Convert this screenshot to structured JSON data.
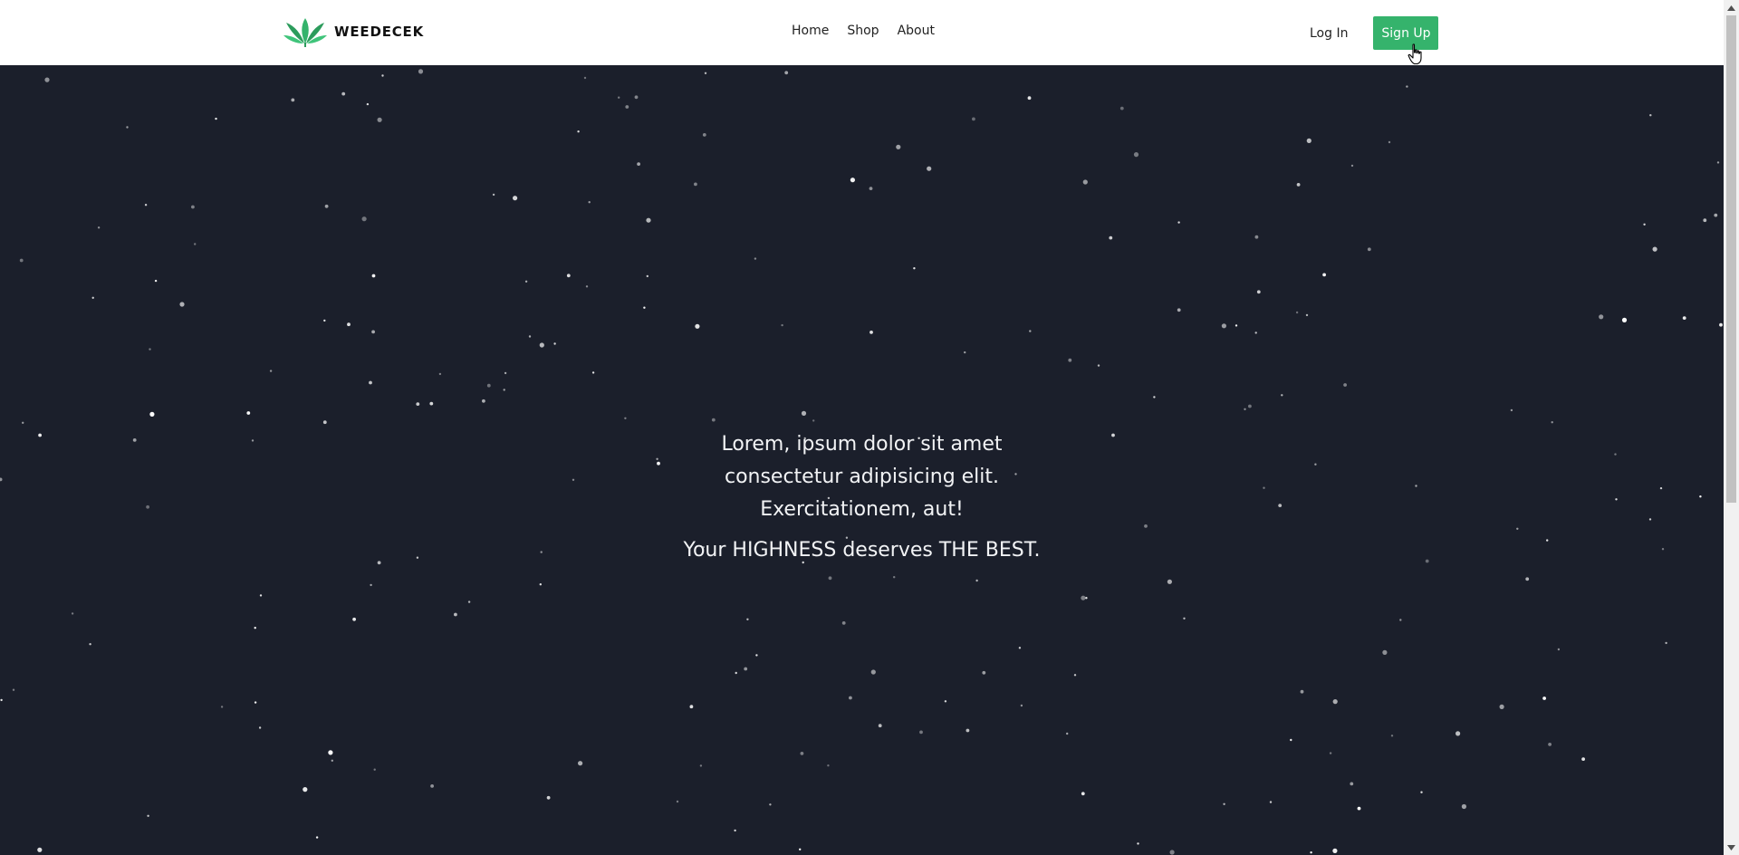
{
  "brand": {
    "name": "WEEDECEK",
    "logo_icon": "cannabis-leaf-icon",
    "logo_color": "#35b36c"
  },
  "nav": {
    "links": [
      "Home",
      "Shop",
      "About"
    ]
  },
  "auth": {
    "login_label": "Log In",
    "signup_label": "Sign Up",
    "signup_color": "#35b36c"
  },
  "hero": {
    "lines": [
      "Lorem, ipsum dolor sit amet",
      "consectetur adipisicing elit.",
      "Exercitationem, aut!"
    ],
    "tagline": "Your HIGHNESS deserves THE BEST.",
    "background_color": "#1b1f2b",
    "background_effect": "starfield-particles"
  },
  "scrollbar": {
    "up_icon": "scroll-up-arrow-icon",
    "down_icon": "scroll-down-arrow-icon"
  },
  "cursor": {
    "icon": "hand-pointer-cursor-icon"
  }
}
